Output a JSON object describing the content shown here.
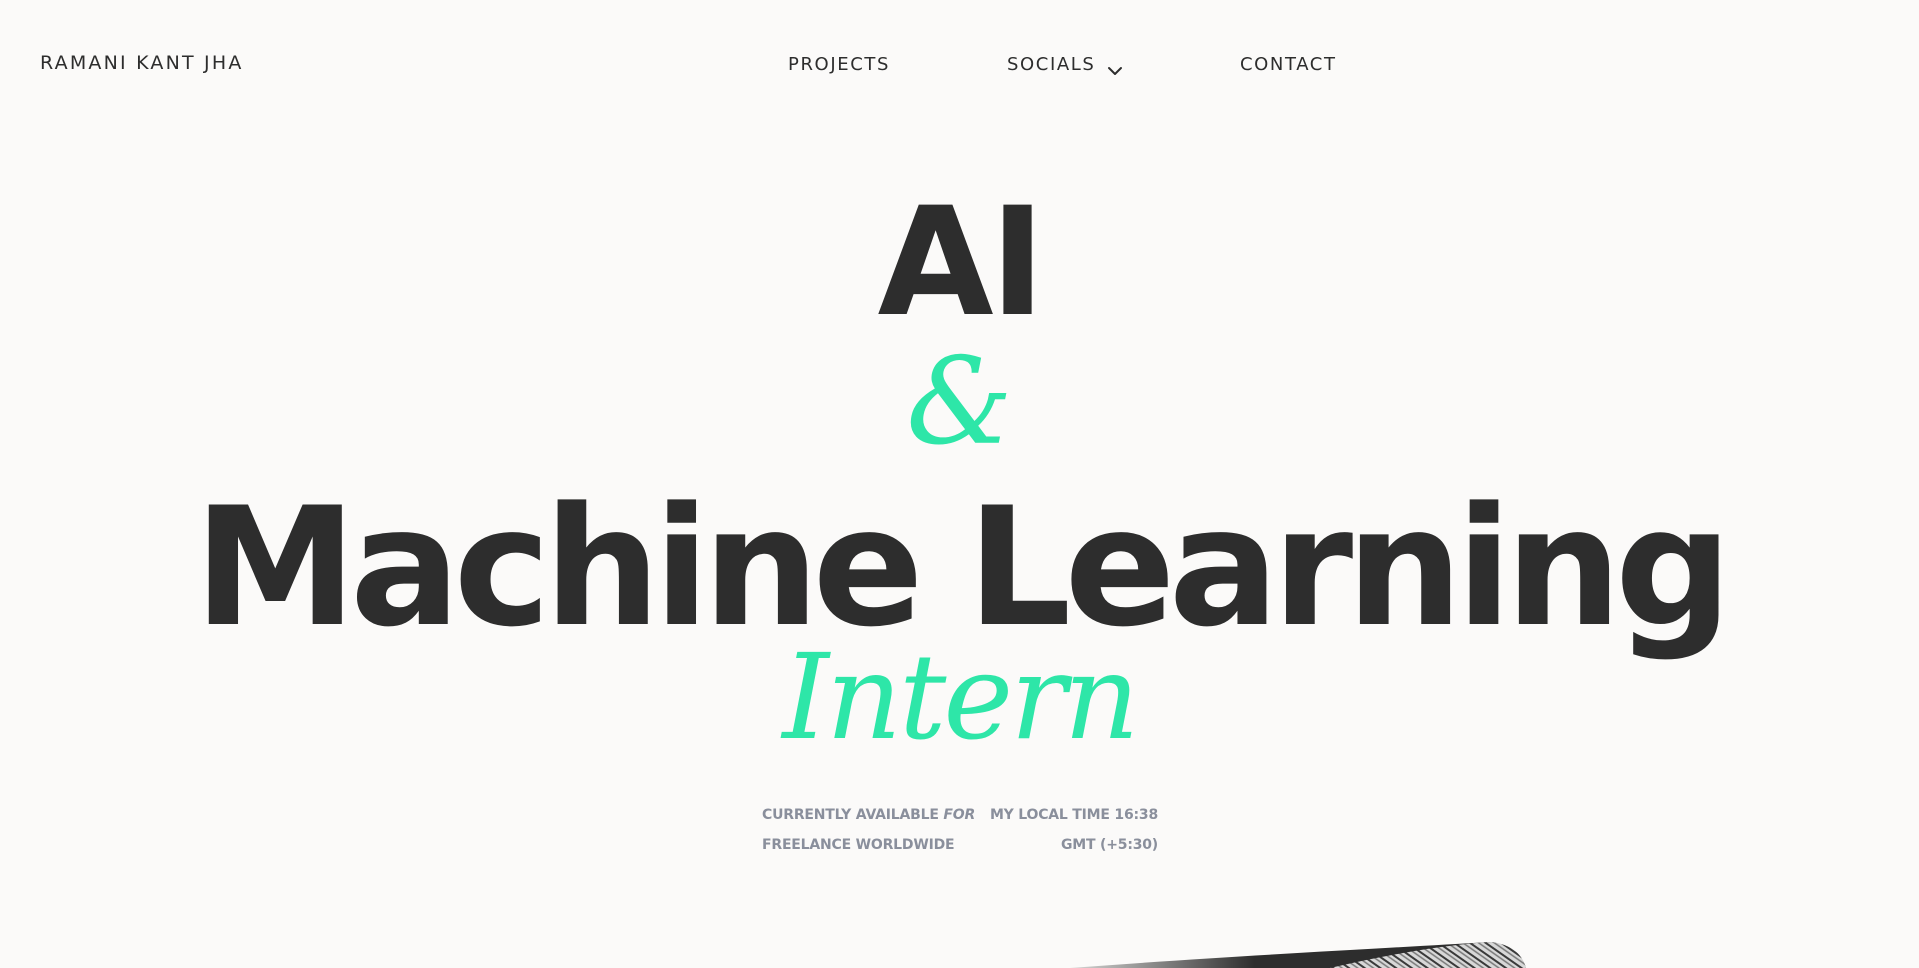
{
  "header": {
    "brand": "RAMANI KANT JHA",
    "nav": {
      "projects": "PROJECTS",
      "socials": "SOCIALS",
      "contact": "CONTACT"
    }
  },
  "hero": {
    "line1": "AI",
    "ampersand": "&",
    "line2": "Machine Learning",
    "line3": "Intern"
  },
  "info": {
    "availability_prefix": "CURRENTLY AVAILABLE",
    "availability_emphasis": "FOR",
    "availability_line2": "FREELANCE WORLDWIDE",
    "time_line1": "MY LOCAL TIME 16:38",
    "time_line2": "GMT (+5:30)"
  },
  "icons": {
    "socials_dropdown": "chevron-down-icon"
  },
  "colors": {
    "background": "#fbfaf9",
    "text": "#2d2d2d",
    "accent": "#2ee6a8",
    "muted": "#8a8f9c"
  }
}
